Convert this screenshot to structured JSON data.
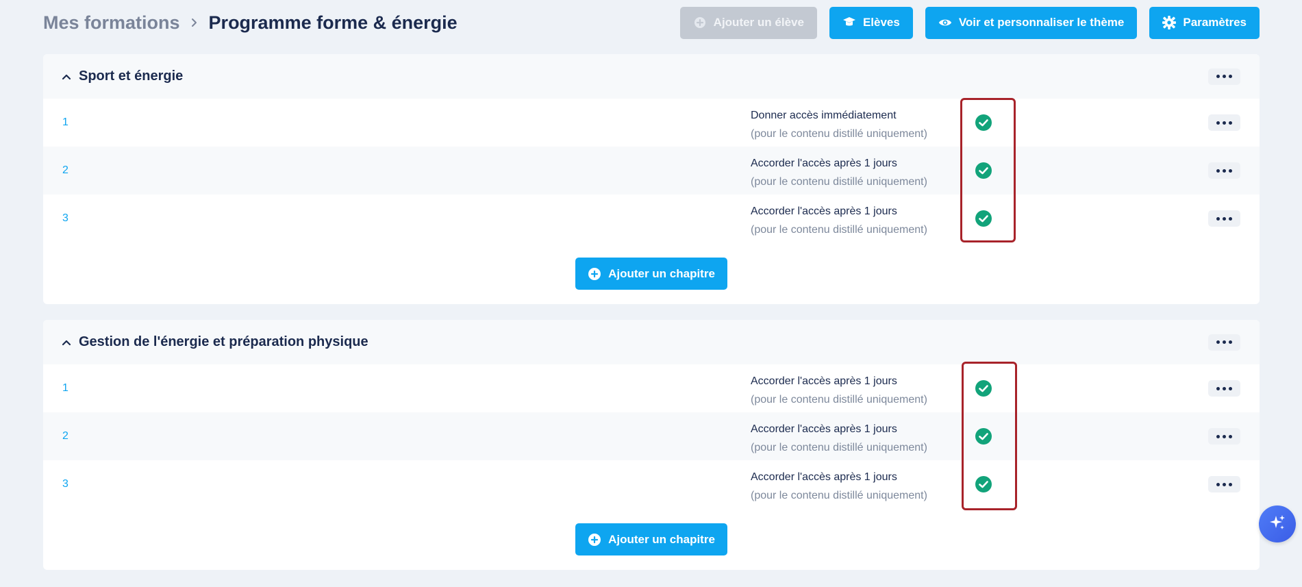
{
  "breadcrumb": {
    "root": "Mes formations",
    "current": "Programme forme & énergie"
  },
  "toolbar": {
    "add_student": "Ajouter un élève",
    "students": "Elèves",
    "theme": "Voir et personnaliser le thème",
    "settings": "Paramètres"
  },
  "sections": [
    {
      "title": "Sport et énergie",
      "add_chapter": "Ajouter un chapitre",
      "rows": [
        {
          "num": "1",
          "access": "Donner accès immédiatement",
          "note": "(pour le contenu distillé uniquement)"
        },
        {
          "num": "2",
          "access": "Accorder l'accès après 1 jours",
          "note": "(pour le contenu distillé uniquement)"
        },
        {
          "num": "3",
          "access": "Accorder l'accès après 1 jours",
          "note": "(pour le contenu distillé uniquement)"
        }
      ]
    },
    {
      "title": "Gestion de l'énergie et préparation physique",
      "add_chapter": "Ajouter un chapitre",
      "rows": [
        {
          "num": "1",
          "access": "Accorder l'accès après 1 jours",
          "note": "(pour le contenu distillé uniquement)"
        },
        {
          "num": "2",
          "access": "Accorder l'accès après 1 jours",
          "note": "(pour le contenu distillé uniquement)"
        },
        {
          "num": "3",
          "access": "Accorder l'accès après 1 jours",
          "note": "(pour le contenu distillé uniquement)"
        }
      ]
    }
  ],
  "colors": {
    "accent": "#0ea5f0",
    "check": "#12a37a",
    "highlight": "#a8232a"
  }
}
